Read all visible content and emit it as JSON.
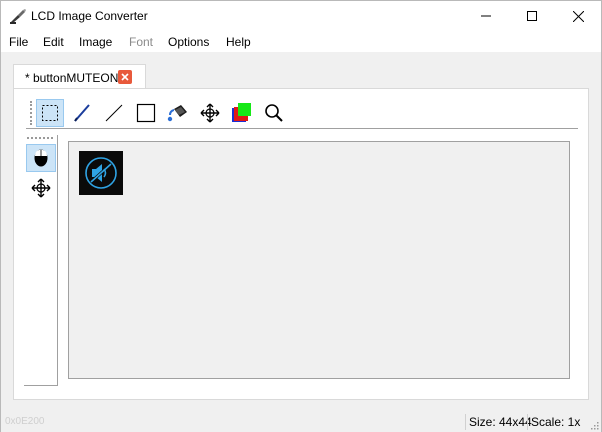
{
  "window": {
    "title": "LCD Image Converter"
  },
  "menu": {
    "items": [
      {
        "label": "File",
        "enabled": true
      },
      {
        "label": "Edit",
        "enabled": true
      },
      {
        "label": "Image",
        "enabled": true
      },
      {
        "label": "Font",
        "enabled": false
      },
      {
        "label": "Options",
        "enabled": true
      },
      {
        "label": "Help",
        "enabled": true
      }
    ]
  },
  "tab": {
    "label": "* buttonMUTEON1"
  },
  "toolbar": {
    "tools": [
      {
        "icon": "rect-selection-icon",
        "active": true
      },
      {
        "icon": "pen-icon",
        "active": false
      },
      {
        "icon": "line-icon",
        "active": false
      },
      {
        "icon": "rectangle-icon",
        "active": false
      },
      {
        "icon": "fill-bucket-icon",
        "active": false
      },
      {
        "icon": "move-icon",
        "active": false
      },
      {
        "icon": "color-swap-icon",
        "active": false
      },
      {
        "icon": "zoom-icon",
        "active": false
      }
    ],
    "left_tools": [
      {
        "icon": "mouse-icon",
        "active": true
      },
      {
        "icon": "move-icon",
        "active": false
      }
    ]
  },
  "colors": {
    "accent_selected": "#cce4f7",
    "tab_close": "#e8593b",
    "mute_icon": "#2fa3e4"
  },
  "status": {
    "faded_text": "0x0E200",
    "size": "Size: 44x44",
    "scale": "Scale: 1x"
  }
}
